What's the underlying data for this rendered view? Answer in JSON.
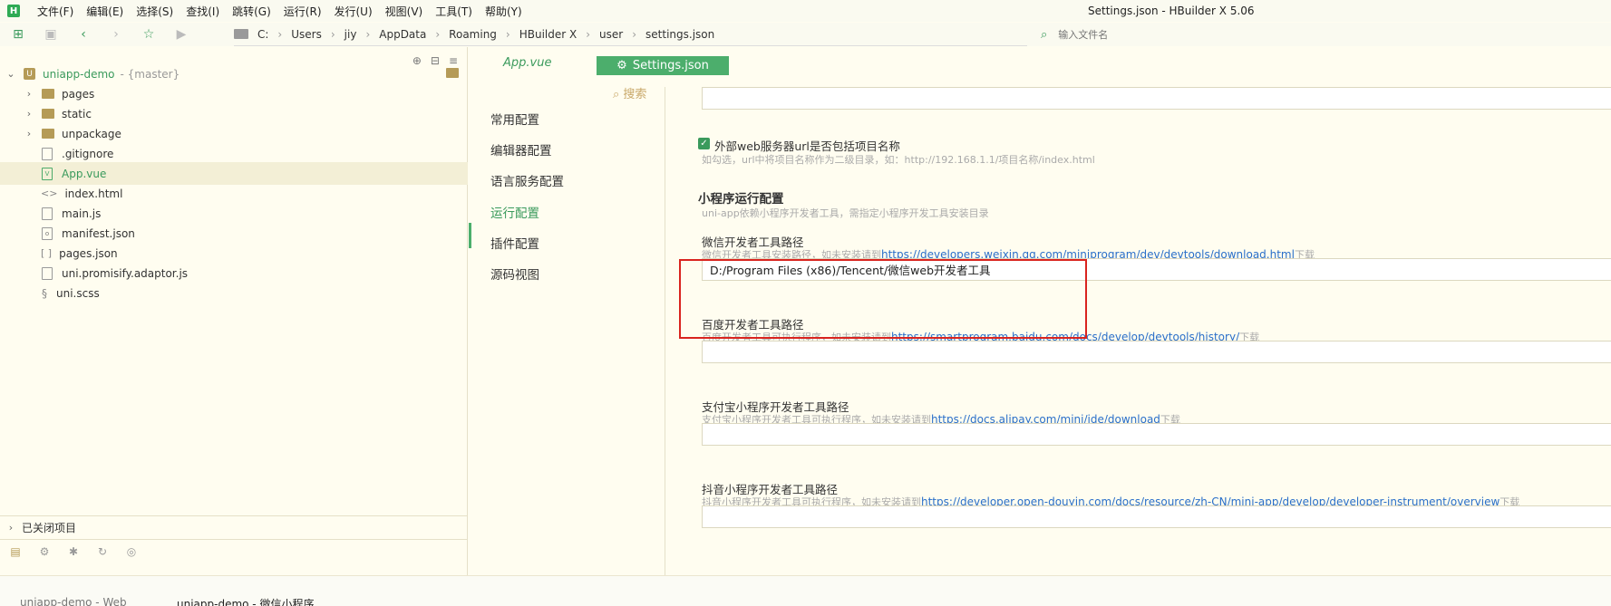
{
  "window_title": "Settings.json - HBuilder X 5.06",
  "menu": [
    "文件(F)",
    "编辑(E)",
    "选择(S)",
    "查找(I)",
    "跳转(G)",
    "运行(R)",
    "发行(U)",
    "视图(V)",
    "工具(T)",
    "帮助(Y)"
  ],
  "breadcrumb": [
    "C:",
    "Users",
    "jiy",
    "AppData",
    "Roaming",
    "HBuilder X",
    "user",
    "settings.json"
  ],
  "file_search": {
    "placeholder": "输入文件名"
  },
  "project": {
    "name": "uniapp-demo",
    "branch": "- {master}"
  },
  "tree": [
    {
      "label": "pages",
      "kind": "folder"
    },
    {
      "label": "static",
      "kind": "folder"
    },
    {
      "label": "unpackage",
      "kind": "folder"
    },
    {
      "label": ".gitignore",
      "kind": "file"
    },
    {
      "label": "App.vue",
      "kind": "vue",
      "selected": true
    },
    {
      "label": "index.html",
      "kind": "html"
    },
    {
      "label": "main.js",
      "kind": "js"
    },
    {
      "label": "manifest.json",
      "kind": "json"
    },
    {
      "label": "pages.json",
      "kind": "json"
    },
    {
      "label": "uni.promisify.adaptor.js",
      "kind": "js"
    },
    {
      "label": "uni.scss",
      "kind": "scss"
    }
  ],
  "closed_projects": "已关闭项目",
  "editor_tabs": {
    "app_vue": "App.vue",
    "settings": "Settings.json"
  },
  "settings_nav": {
    "search": "搜索",
    "items": [
      "常用配置",
      "编辑器配置",
      "语言服务配置",
      "运行配置",
      "插件配置",
      "源码视图"
    ],
    "active_index": 3
  },
  "settings": {
    "web_server_checkbox": "外部web服务器url是否包括项目名称",
    "web_server_hint": "如勾选，url中将项目名称作为二级目录，如：http://192.168.1.1/项目名称/index.html",
    "mini_section_title": "小程序运行配置",
    "mini_section_hint": "uni-app依赖小程序开发者工具，需指定小程序开发工具安装目录",
    "wechat": {
      "label": "微信开发者工具路径",
      "hint_prefix": "微信开发者工具安装路径，如未安装请到",
      "link": "https://developers.weixin.qq.com/miniprogram/dev/devtools/download.html",
      "hint_suffix": "下载",
      "value": "D:/Program Files (x86)/Tencent/微信web开发者工具"
    },
    "baidu": {
      "label": "百度开发者工具路径",
      "hint_prefix": "百度开发者工具可执行程序，如未安装请到",
      "link": "https://smartprogram.baidu.com/docs/develop/devtools/history/",
      "hint_suffix": "下载",
      "value": ""
    },
    "alipay": {
      "label": "支付宝小程序开发者工具路径",
      "hint_prefix": "支付宝小程序开发者工具可执行程序，如未安装请到",
      "link": "https://docs.alipay.com/mini/ide/download",
      "hint_suffix": "下载",
      "value": ""
    },
    "douyin": {
      "label": "抖音小程序开发者工具路径",
      "hint_prefix": "抖音小程序开发者工具可执行程序，如未安装请到",
      "link": "https://developer.open-douyin.com/docs/resource/zh-CN/mini-app/develop/developer-instrument/overview",
      "hint_suffix": "下载"
    }
  },
  "status_tabs": [
    "uniapp-demo - Web",
    "uniapp-demo - 微信小程序"
  ],
  "colors": {
    "accent": "#3a9a5c",
    "highlight": "#d9241f",
    "link": "#2a6fc9"
  }
}
